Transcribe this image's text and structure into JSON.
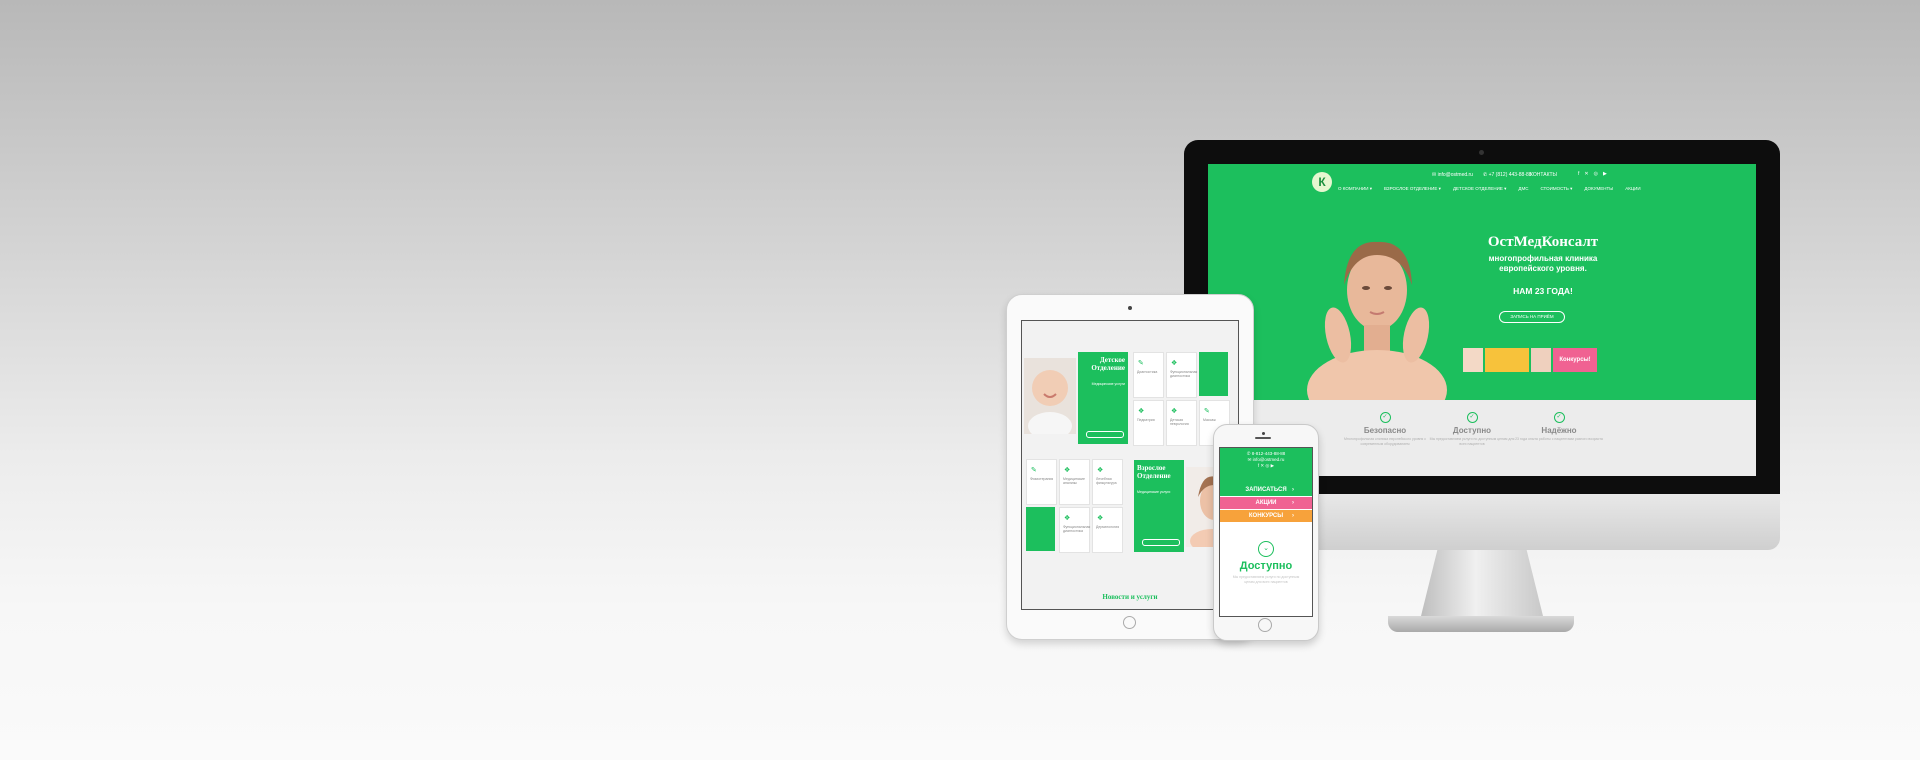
{
  "colors": {
    "brand_green": "#1cbf5d",
    "pink": "#f06292",
    "orange": "#f7a23b",
    "teal": "#21b3a6"
  },
  "imac": {
    "email": "info@ostmed.ru",
    "phone": "+7 (812) 443-88-88",
    "contacts": "КОНТАКТЫ",
    "social_icons": [
      "facebook-icon",
      "vk-icon",
      "instagram-icon",
      "youtube-icon"
    ],
    "nav": [
      "О КОМПАНИИ ▾",
      "ВЗРОСЛОЕ ОТДЕЛЕНИЕ ▾",
      "ДЕТСКОЕ ОТДЕЛЕНИЕ ▾",
      "ДМС",
      "СТОИМОСТЬ ▾",
      "ДОКУМЕНТЫ",
      "АКЦИИ"
    ],
    "hero": {
      "title": "ОстМедКонсалт",
      "subtitle_1": "многопрофильная клиника",
      "subtitle_2": "европейского уровня.",
      "years": "НАМ 23 ГОДА!",
      "cta": "ЗАПИСЬ НА ПРИЁМ",
      "promo_label": "Конкурсы!"
    },
    "features": [
      {
        "title": "Безопасно",
        "text": "Многопрофильная клиника европейского уровня с современным оборудованием"
      },
      {
        "title": "Доступно",
        "text": "Мы предоставляем услуги по доступным ценам для всех пациентов"
      },
      {
        "title": "Надёжно",
        "text": "23 года опыта работы с пациентами разного возраста"
      }
    ]
  },
  "ipad": {
    "kids_title_1": "Детское",
    "kids_title_2": "Отделение",
    "kids_sub": "Медицинские услуги",
    "adult_title_1": "Взрослое",
    "adult_title_2": "Отделение",
    "adult_sub": "Медицинские услуги",
    "tiles": [
      "Диагностика",
      "Функциональная диагностика",
      "Педиатрия",
      "Детская неврология",
      "Массаж",
      "Физиотерапия",
      "Медицинские анализы",
      "Лечебная физкультура",
      "Функциональная диагностика",
      "Дерматология",
      "Гинекология"
    ],
    "footer": "Новости и услуги"
  },
  "phone": {
    "phone": "8-812-443-88-88",
    "email": "info@ostmed.ru",
    "bars": [
      "ЗАПИСАТЬСЯ",
      "АКЦИИ",
      "КОНКУРСЫ"
    ],
    "word": "Доступно",
    "desc": "Мы предоставляем услуги по доступным ценам для всех пациентов"
  }
}
